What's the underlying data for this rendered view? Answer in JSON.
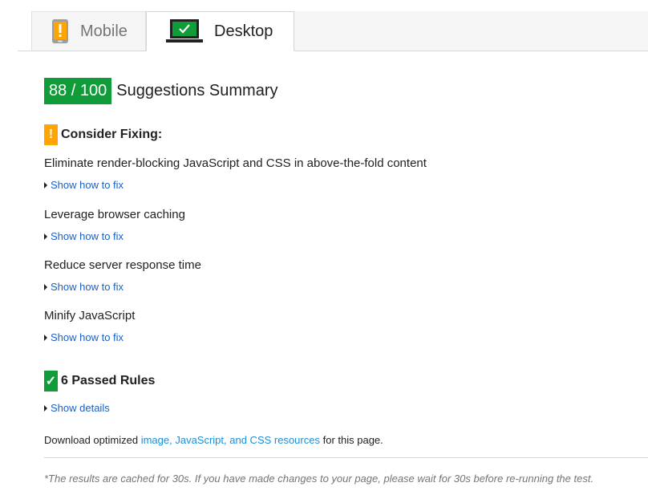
{
  "tabs": [
    {
      "label": "Mobile",
      "icon": "phone-warning-icon",
      "active": false
    },
    {
      "label": "Desktop",
      "icon": "laptop-check-icon",
      "active": true
    }
  ],
  "summary": {
    "score": "88 / 100",
    "title": "Suggestions Summary",
    "score_color": "#109d39"
  },
  "consider_fixing": {
    "label": "Consider Fixing:",
    "icon": "warning-icon",
    "color": "#ffa400",
    "rules": [
      {
        "title": "Eliminate render-blocking JavaScript and CSS in above-the-fold content",
        "toggle": "Show how to fix"
      },
      {
        "title": "Leverage browser caching",
        "toggle": "Show how to fix"
      },
      {
        "title": "Reduce server response time",
        "toggle": "Show how to fix"
      },
      {
        "title": "Minify JavaScript",
        "toggle": "Show how to fix"
      }
    ]
  },
  "passed": {
    "label": "6 Passed Rules",
    "icon": "check-icon",
    "toggle": "Show details"
  },
  "download": {
    "prefix": "Download optimized",
    "link": "image, JavaScript, and CSS resources",
    "suffix": "for this page."
  },
  "cache_note": "*The results are cached for 30s. If you have made changes to your page, please wait for 30s before re-running the test."
}
